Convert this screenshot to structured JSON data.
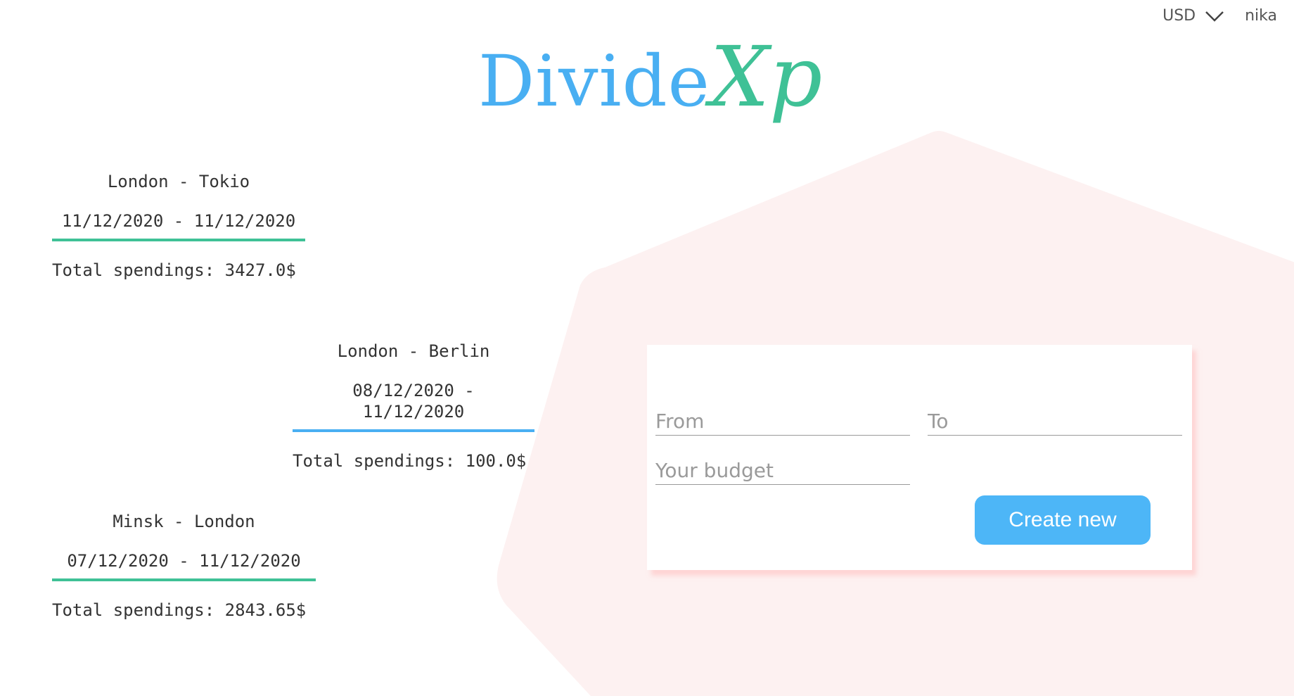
{
  "header": {
    "currency": "USD",
    "username": "nika"
  },
  "logo": {
    "part1": "Divide",
    "part2": "Xp",
    "part1_color": "#49aff2",
    "part2_color": "#3fc196"
  },
  "trips": [
    {
      "route": "London - Tokio",
      "dates": "11/12/2020 - 11/12/2020",
      "total": "Total spendings: 3427.0$",
      "accent": "#3fc196"
    },
    {
      "route": "London - Berlin",
      "dates": "08/12/2020 - 11/12/2020",
      "total": "Total spendings: 100.0$",
      "accent": "#49aff2"
    },
    {
      "route": "Minsk - London",
      "dates": "07/12/2020 - 11/12/2020",
      "total": "Total spendings: 2843.65$",
      "accent": "#3fc196"
    }
  ],
  "form": {
    "from_placeholder": "From",
    "to_placeholder": "To",
    "budget_placeholder": "Your budget",
    "from_value": "",
    "to_value": "",
    "budget_value": "",
    "create_label": "Create new",
    "button_color": "#4db6f7"
  },
  "colors": {
    "background_shape": "#fdf1f1",
    "card_shadow": "#ffc8c8"
  },
  "icons": {
    "currency_dropdown": "chevron-down-icon"
  }
}
